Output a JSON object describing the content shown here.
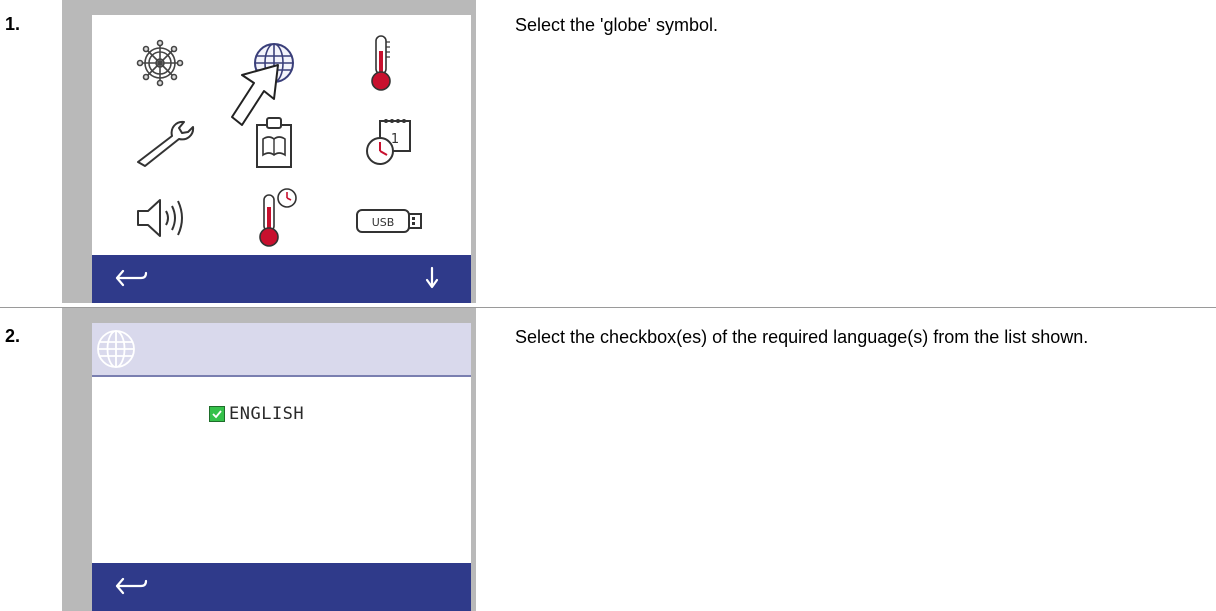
{
  "steps": [
    {
      "number": "1.",
      "instruction": "Select the 'globe' symbol.",
      "screen": {
        "icons": [
          "steering-wheel-icon",
          "globe-icon",
          "thermometer-icon",
          "wrench-icon",
          "manual-icon",
          "clock-calendar-icon",
          "speaker-icon",
          "thermometer-clock-icon",
          "usb-stick-icon"
        ],
        "usb_label": "USB"
      }
    },
    {
      "number": "2.",
      "instruction": "Select the checkbox(es) of the required language(s) from the list shown.",
      "screen": {
        "languages": [
          {
            "label": "ENGLISH",
            "checked": true
          }
        ]
      }
    }
  ],
  "colors": {
    "bar": "#2f3a8a",
    "header": "#d9d9ec",
    "checkbox": "#35c14a",
    "thermometer": "#c8102e"
  }
}
